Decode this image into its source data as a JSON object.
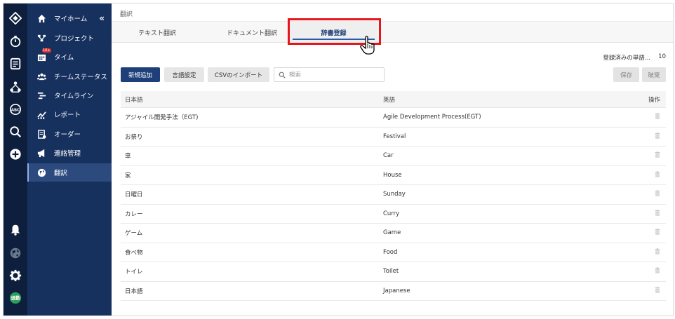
{
  "sidebar": {
    "collapse_label": "«",
    "items": [
      {
        "label": "マイホーム",
        "icon": "home-icon"
      },
      {
        "label": "プロジェクト",
        "icon": "project-tree-icon"
      },
      {
        "label": "タイム",
        "icon": "calendar-icon",
        "badge": "10+"
      },
      {
        "label": "チームステータス",
        "icon": "team-icon"
      },
      {
        "label": "タイムライン",
        "icon": "timeline-icon"
      },
      {
        "label": "レポート",
        "icon": "report-chart-icon"
      },
      {
        "label": "オーダー",
        "icon": "order-icon"
      },
      {
        "label": "連絡管理",
        "icon": "megaphone-icon"
      },
      {
        "label": "翻訳",
        "icon": "globe-icon",
        "active": true
      }
    ]
  },
  "rail": {
    "user_badge": "退勤"
  },
  "page": {
    "breadcrumb": "翻訳",
    "tabs": [
      {
        "label": "テキスト翻訳"
      },
      {
        "label": "ドキュメント翻訳"
      },
      {
        "label": "辞書登録",
        "active": true
      }
    ],
    "registered_label": "登録済みの単語...",
    "registered_count": "10"
  },
  "toolbar": {
    "new_label": "新規追加",
    "lang_label": "言語設定",
    "csv_label": "CSVのインポート",
    "search_placeholder": "検索",
    "save_label": "保存",
    "discard_label": "破棄"
  },
  "table": {
    "headers": {
      "japanese": "日本語",
      "english": "英語",
      "actions": "操作"
    },
    "rows": [
      {
        "ja": "アジャイル開発手法（EGT)",
        "en": "Agile Development Process(EGT)"
      },
      {
        "ja": "お祭り",
        "en": "Festival"
      },
      {
        "ja": "車",
        "en": "Car"
      },
      {
        "ja": "家",
        "en": "House"
      },
      {
        "ja": "日曜日",
        "en": "Sunday"
      },
      {
        "ja": "カレー",
        "en": "Curry"
      },
      {
        "ja": "ゲーム",
        "en": "Game"
      },
      {
        "ja": "食べ物",
        "en": "Food"
      },
      {
        "ja": "トイレ",
        "en": "Toilet"
      },
      {
        "ja": "日本語",
        "en": "Japanese"
      }
    ]
  },
  "colors": {
    "rail": "#0e1f3d",
    "sidebar": "#17315f",
    "primary_button": "#1e3f7a",
    "highlight": "#e5161d"
  }
}
